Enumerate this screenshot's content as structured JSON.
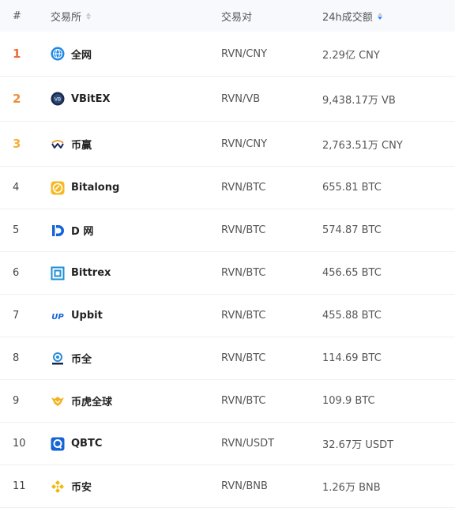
{
  "header": {
    "rank": "#",
    "exchange": "交易所",
    "pair": "交易对",
    "volume": "24h成交额"
  },
  "rows": [
    {
      "rank": "1",
      "name": "全网",
      "pair": "RVN/CNY",
      "volume": "2.29亿 CNY",
      "icon": "globe-icon"
    },
    {
      "rank": "2",
      "name": "VBitEX",
      "pair": "RVN/VB",
      "volume": "9,438.17万 VB",
      "icon": "vbitex-logo-icon"
    },
    {
      "rank": "3",
      "name": "币赢",
      "pair": "RVN/CNY",
      "volume": "2,763.51万 CNY",
      "icon": "biying-logo-icon"
    },
    {
      "rank": "4",
      "name": "Bitalong",
      "pair": "RVN/BTC",
      "volume": "655.81 BTC",
      "icon": "bitalong-logo-icon"
    },
    {
      "rank": "5",
      "name": "D 网",
      "pair": "RVN/BTC",
      "volume": "574.87 BTC",
      "icon": "dcoin-logo-icon"
    },
    {
      "rank": "6",
      "name": "Bittrex",
      "pair": "RVN/BTC",
      "volume": "456.65 BTC",
      "icon": "bittrex-logo-icon"
    },
    {
      "rank": "7",
      "name": "Upbit",
      "pair": "RVN/BTC",
      "volume": "455.88 BTC",
      "icon": "upbit-logo-icon"
    },
    {
      "rank": "8",
      "name": "币全",
      "pair": "RVN/BTC",
      "volume": "114.69 BTC",
      "icon": "coinall-logo-icon"
    },
    {
      "rank": "9",
      "name": "币虎全球",
      "pair": "RVN/BTC",
      "volume": "109.9 BTC",
      "icon": "bihu-logo-icon"
    },
    {
      "rank": "10",
      "name": "QBTC",
      "pair": "RVN/USDT",
      "volume": "32.67万 USDT",
      "icon": "qbtc-logo-icon"
    },
    {
      "rank": "11",
      "name": "币安",
      "pair": "RVN/BNB",
      "volume": "1.26万 BNB",
      "icon": "binance-logo-icon"
    }
  ]
}
